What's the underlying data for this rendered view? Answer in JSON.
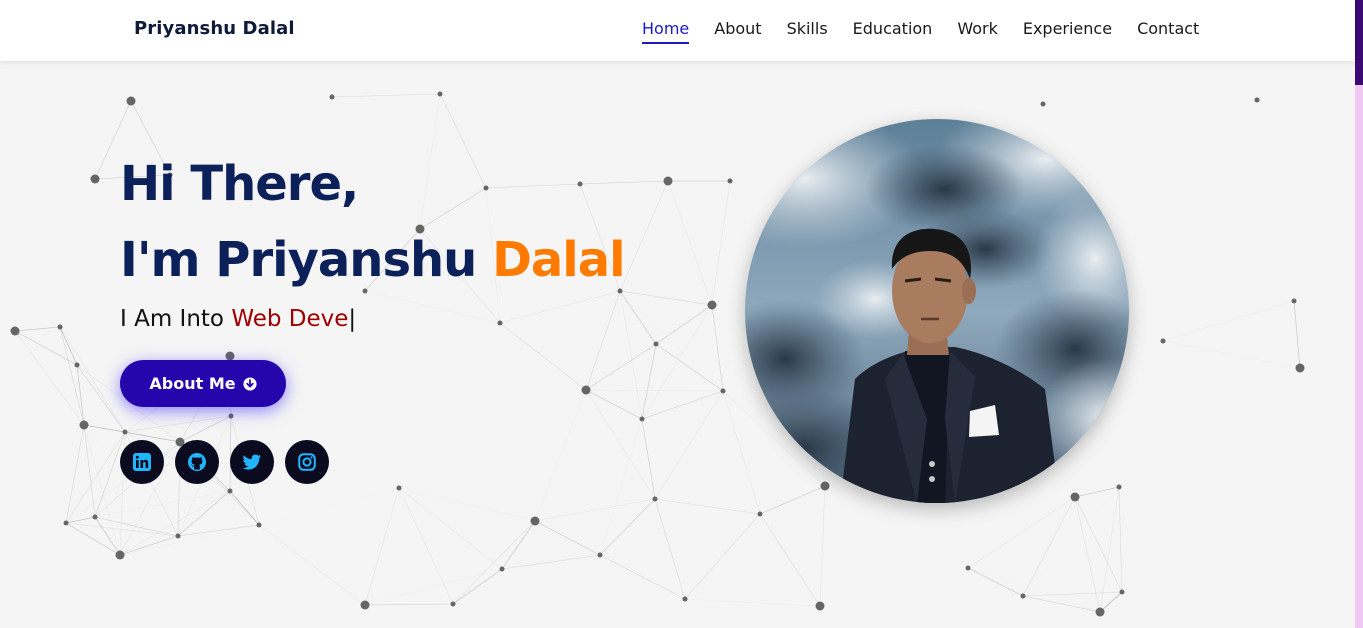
{
  "brand": "Priyanshu Dalal",
  "nav": {
    "items": [
      "Home",
      "About",
      "Skills",
      "Education",
      "Work",
      "Experience",
      "Contact"
    ],
    "active": "Home"
  },
  "hero": {
    "line1": "Hi There,",
    "line2_prefix": "I'm Priyanshu ",
    "line2_accent": "Dalal",
    "typed_prefix": "I Am Into ",
    "typed_role": "Web Deve",
    "typed_cursor": "|",
    "button_label": "About Me"
  },
  "socials": [
    "linkedin-icon",
    "github-icon",
    "twitter-icon",
    "instagram-icon"
  ],
  "colors": {
    "title": "#0c2159",
    "accent": "#ff7b00",
    "role": "#a00000",
    "button": "#2506ad",
    "nav_active": "#1b1bbd",
    "social_bg": "#0b0b1f",
    "social_icon": "#1fb6ff"
  }
}
